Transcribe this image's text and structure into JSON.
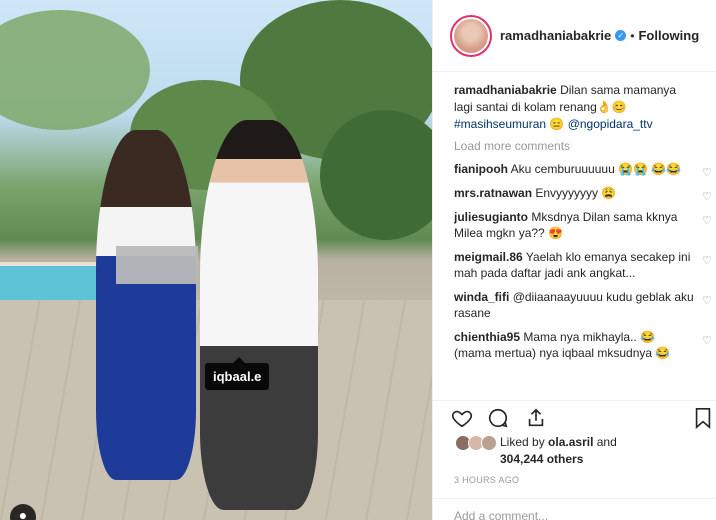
{
  "post": {
    "username": "ramadhaniabakrie",
    "follow_status": "Following",
    "dot": "•",
    "caption_user": "ramadhaniabakrie",
    "caption_text": "Dilan sama mamanya lagi santai di kolam renang👌😊",
    "caption_tag1": "#masihseumuran",
    "caption_emoji": "😑",
    "caption_mention": "@ngopidara_ttv",
    "load_more": "Load more comments",
    "photo_tag": "iqbaal.e",
    "comments": [
      {
        "user": "fianipooh",
        "text": "Aku cemburuuuuuu 😭😭 😂😂"
      },
      {
        "user": "mrs.ratnawan",
        "text": "Envyyyyyyy 😩"
      },
      {
        "user": "juliesugianto",
        "text": "Mksdnya Dilan sama kknya Milea mgkn ya?? 😍"
      },
      {
        "user": "meigmail.86",
        "text": "Yaelah klo emanya secakep ini mah pada daftar jadi ank angkat..."
      },
      {
        "user": "winda_fifi",
        "text": "@diiaanaayuuuu kudu geblak aku rasane"
      },
      {
        "user": "chienthia95",
        "text": "Mama nya mikhayla.. 😂 (mama mertua) nya iqbaal mksudnya 😂"
      }
    ],
    "likes_prefix": "Liked by",
    "likes_user": "ola.asril",
    "likes_and": "and",
    "likes_count": "304,244 others",
    "time_ago": "3 HOURS AGO",
    "add_comment_placeholder": "Add a comment...",
    "colors": {
      "accent": "#3897f0",
      "hashtag": "#003569",
      "ring": "#e1306c"
    },
    "icons": [
      "heart-icon",
      "comment-icon",
      "share-icon",
      "bookmark-icon",
      "user-tag-icon",
      "verified-badge-icon"
    ]
  }
}
